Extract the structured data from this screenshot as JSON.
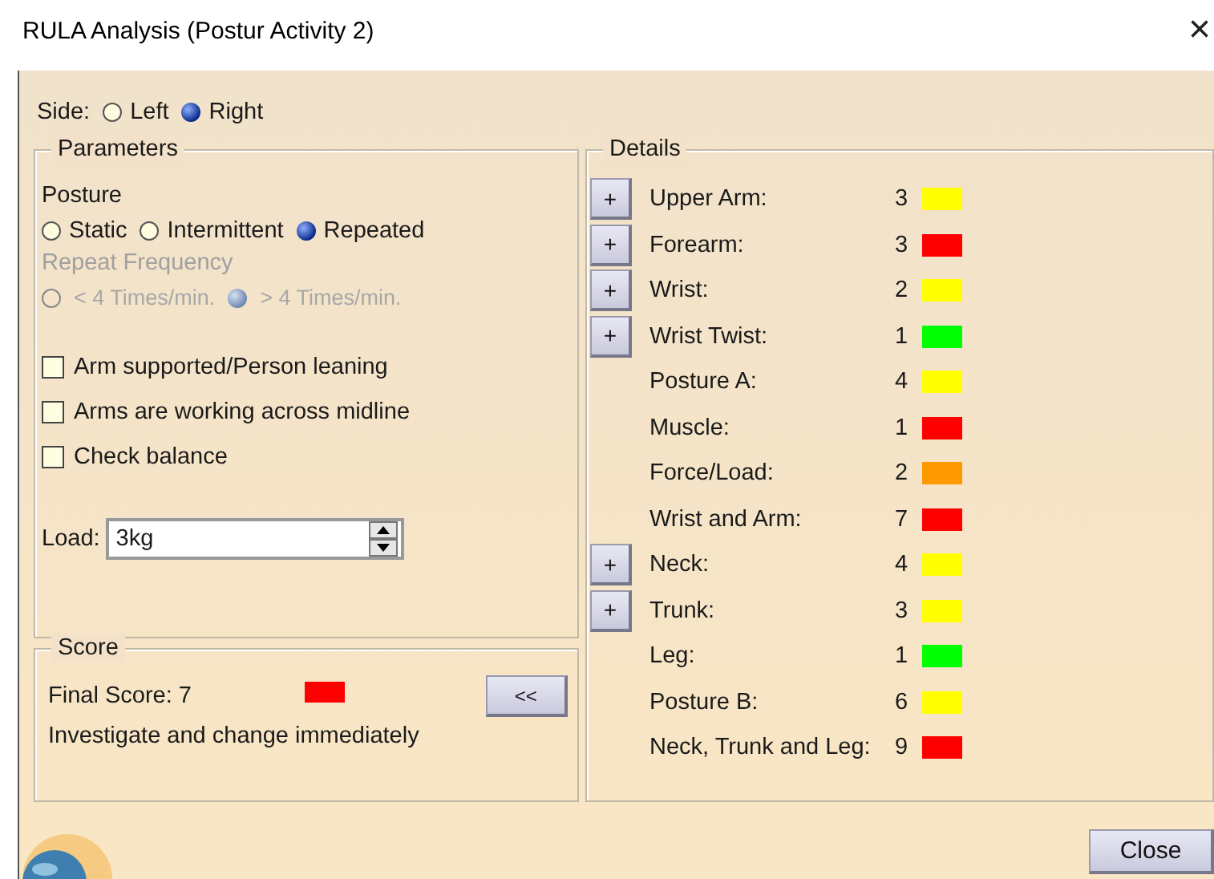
{
  "window": {
    "title": "RULA Analysis (Postur Activity 2)",
    "close": "×"
  },
  "side": {
    "label": "Side:",
    "options": [
      {
        "label": "Left",
        "selected": false
      },
      {
        "label": "Right",
        "selected": true
      }
    ]
  },
  "parameters": {
    "title": "Parameters",
    "posture": {
      "label": "Posture",
      "options": [
        {
          "label": "Static",
          "selected": false
        },
        {
          "label": "Intermittent",
          "selected": false
        },
        {
          "label": "Repeated",
          "selected": true
        }
      ]
    },
    "repeat_frequency": {
      "label": "Repeat Frequency",
      "disabled": true,
      "options": [
        {
          "label": "< 4 Times/min.",
          "selected": false
        },
        {
          "label": "> 4 Times/min.",
          "selected": true
        }
      ]
    },
    "checkboxes": [
      {
        "label": "Arm supported/Person leaning",
        "checked": false
      },
      {
        "label": "Arms are working across midline",
        "checked": false
      },
      {
        "label": "Check balance",
        "checked": false
      }
    ],
    "load": {
      "label": "Load:",
      "value": "3kg"
    }
  },
  "score": {
    "title": "Score",
    "final": "Final Score: 7",
    "color": "#ff0000",
    "message": "Investigate and change immediately",
    "toggle": "<<"
  },
  "details": {
    "title": "Details",
    "rows": [
      {
        "label": "Upper Arm:",
        "value": "3",
        "color": "#ffff00",
        "button": "+"
      },
      {
        "label": "Forearm:",
        "value": "3",
        "color": "#ff0000",
        "button": "+"
      },
      {
        "label": "Wrist:",
        "value": "2",
        "color": "#ffff00",
        "button": "+"
      },
      {
        "label": "Wrist Twist:",
        "value": "1",
        "color": "#00ff00",
        "button": "+"
      },
      {
        "label": "Posture A:",
        "value": "4",
        "color": "#ffff00"
      },
      {
        "label": "Muscle:",
        "value": "1",
        "color": "#ff0000"
      },
      {
        "label": "Force/Load:",
        "value": "2",
        "color": "#ff9900"
      },
      {
        "label": "Wrist and Arm:",
        "value": "7",
        "color": "#ff0000"
      },
      {
        "label": "Neck:",
        "value": "4",
        "color": "#ffff00",
        "button": "+"
      },
      {
        "label": "Trunk:",
        "value": "3",
        "color": "#ffff00",
        "button": "+"
      },
      {
        "label": "Leg:",
        "value": "1",
        "color": "#00ff00"
      },
      {
        "label": "Posture B:",
        "value": "6",
        "color": "#ffff00"
      },
      {
        "label": "Neck, Trunk and Leg:",
        "value": "9",
        "color": "#ff0000"
      }
    ]
  },
  "buttons": [
    "Close"
  ]
}
